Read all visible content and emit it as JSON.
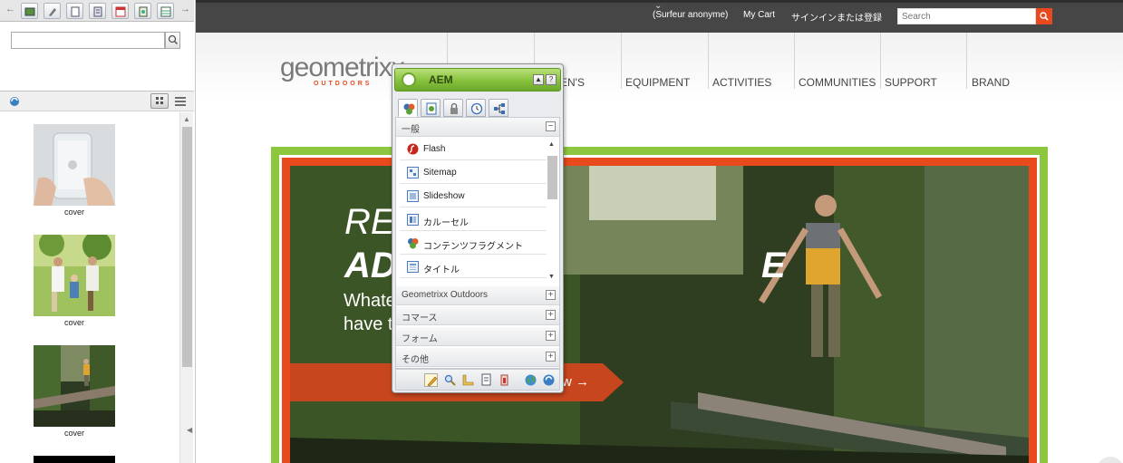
{
  "finder": {
    "search_value": "",
    "assets": [
      {
        "caption": "cover"
      },
      {
        "caption": "cover"
      },
      {
        "caption": "cover"
      }
    ]
  },
  "site": {
    "topbar": {
      "user": "(Surfeur anonyme)",
      "cart": "My Cart",
      "signin": "サインインまたは登録",
      "search_placeholder": "Search"
    },
    "logo": {
      "main": "geometrixx",
      "sub": "OUTDOORS"
    },
    "nav": [
      "EN'S",
      "EQUIPMENT",
      "ACTIVITIES",
      "COMMUNITIES",
      "SUPPORT",
      "BRAND"
    ],
    "hero": {
      "line1": "RE",
      "line2": "AD",
      "line2_end": "E",
      "line3": "Whate",
      "line4": "have t",
      "cta": "w →"
    }
  },
  "sidekick": {
    "title": "AEM",
    "group_open": "一般",
    "components": [
      {
        "label": "Flash",
        "icon": "flash-icon"
      },
      {
        "label": "Sitemap",
        "icon": "sitemap-icon"
      },
      {
        "label": "Slideshow",
        "icon": "slideshow-icon"
      },
      {
        "label": "カルーセル",
        "icon": "carousel-icon"
      },
      {
        "label": "コンテンツフラグメント",
        "icon": "content-fragment-icon"
      },
      {
        "label": "タイトル",
        "icon": "title-icon"
      }
    ],
    "groups_closed": [
      "Geometrixx Outdoors",
      "コマース",
      "フォーム",
      "その他"
    ]
  },
  "colors": {
    "accent_green": "#8dc63f",
    "brand_orange": "#e8491d",
    "topbar": "#464646"
  }
}
